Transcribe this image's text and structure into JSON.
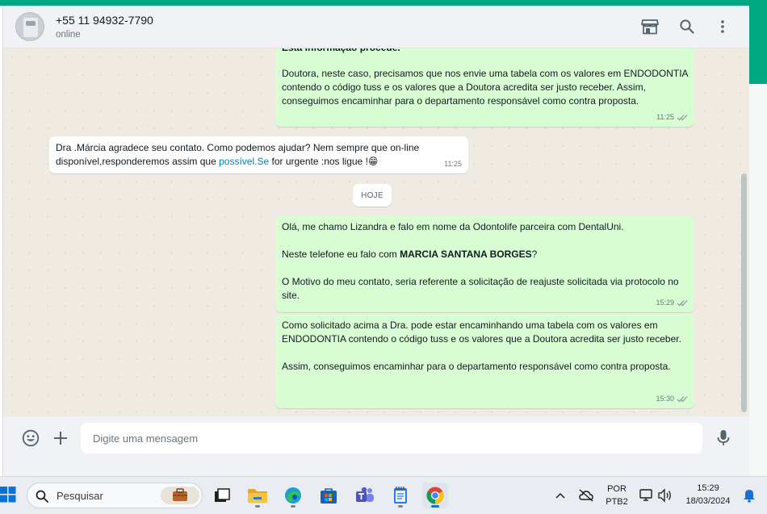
{
  "header": {
    "contact_name": "+55 11 94932-7790",
    "contact_status": "online",
    "icons": [
      "catalog-icon",
      "search-icon",
      "menu-icon"
    ]
  },
  "chat": {
    "messages": [
      {
        "direction": "outgoing",
        "partial_top": "Esta informação procede.",
        "text": "Doutora, neste caso, precisamos que nos envie uma tabela com os valores em ENDODONTIA contendo o código tuss e os valores que a Doutora acredita ser justo receber. Assim, conseguimos encaminhar para o departamento responsável como contra proposta.",
        "time": "11:25"
      },
      {
        "direction": "incoming",
        "text_before_link": "Dra .Márcia agradece seu contato. Como podemos ajudar? Nem sempre que on-line disponível,responderemos assim que ",
        "link": "possível.Se",
        "text_after_link": " for urgente :nos ligue !",
        "emoji": "😁",
        "time": "11:25"
      },
      {
        "direction": "outgoing",
        "line1": "Olá, me chamo Lizandra e falo em nome da Odontolife parceira com DentalUni.",
        "line2_before": "Neste telefone eu falo com ",
        "line2_bold": "MARCIA SANTANA BORGES",
        "line2_after": "?",
        "line3": "O Motivo do meu contato, seria referente a solicitação de reajuste solicitada via protocolo no site.",
        "time": "15:29"
      },
      {
        "direction": "outgoing",
        "line1": "Como solicitado acima a Dra. pode estar encaminhando uma tabela com os valores em ENDODONTIA contendo o código tuss e os valores que a Doutora acredita ser justo receber.",
        "line2": "Assim, conseguimos encaminhar para o departamento responsável como contra proposta.",
        "time": "15:30"
      }
    ],
    "day_separator": "HOJE"
  },
  "footer": {
    "input_placeholder": "Digite uma mensagem",
    "input_value": ""
  },
  "taskbar": {
    "search_placeholder": "Pesquisar",
    "lang_line1": "POR",
    "lang_line2": "PTB2",
    "time": "15:29",
    "date": "18/03/2024"
  },
  "colors": {
    "outgoing_bubble": "#d9fdd3",
    "incoming_bubble": "#ffffff",
    "accent": "#00a884",
    "link": "#027eb5",
    "read_ticks": "#8696a0"
  }
}
